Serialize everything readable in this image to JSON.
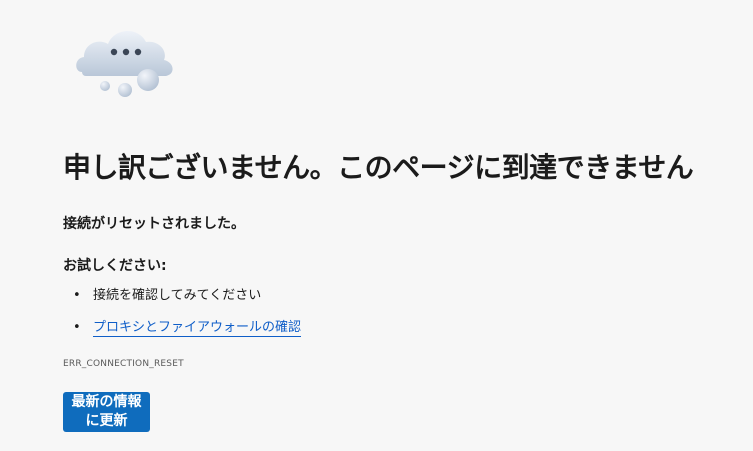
{
  "illustration": {
    "icon": "cloud-ellipsis-icon",
    "colors": {
      "cloud_light": "#dfe7f1",
      "cloud_shade": "#b7c5d6",
      "dots": "#3b4656"
    }
  },
  "error": {
    "title": "申し訳ございません。このページに到達できません",
    "subtitle": "接続がリセットされました。",
    "try_heading": "お試しください:",
    "suggestions": [
      {
        "text": "接続を確認してみてください",
        "is_link": false
      },
      {
        "text": "プロキシとファイアウォールの確認",
        "is_link": true
      }
    ],
    "bullet": "•",
    "code": "ERR_CONNECTION_RESET"
  },
  "actions": {
    "refresh_label": "最新の情報に更新"
  },
  "colors": {
    "background": "#f7f7f7",
    "text": "#1b1b1b",
    "link": "#0f5ec8",
    "button": "#0f6cbd",
    "button_text": "#ffffff"
  }
}
